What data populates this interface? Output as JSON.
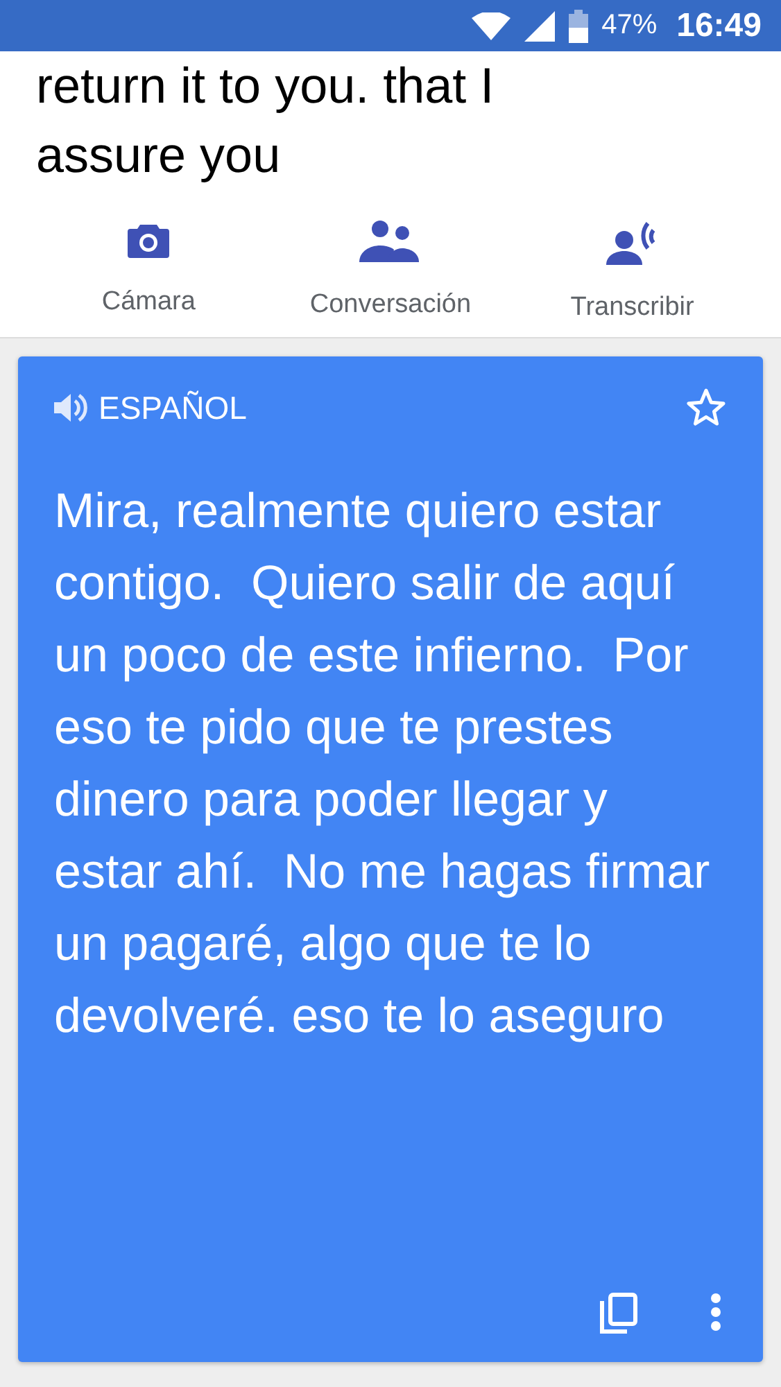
{
  "status_bar": {
    "battery": "47%",
    "time": "16:49"
  },
  "source_text": "return it to you. that I assure you",
  "actions": [
    {
      "kind": "camera",
      "label": "Cámara"
    },
    {
      "kind": "conversation",
      "label": "Conversación"
    },
    {
      "kind": "transcribe",
      "label": "Transcribir"
    }
  ],
  "translation_card": {
    "language": "ESPAÑOL",
    "starred": false,
    "text": "Mira, realmente quiero estar contigo.  Quiero salir de aquí un poco de este infierno.  Por eso te pido que te prestes dinero para poder llegar y estar ahí.  No me hagas firmar un pagaré, algo que te lo devolveré. eso te lo aseguro"
  }
}
